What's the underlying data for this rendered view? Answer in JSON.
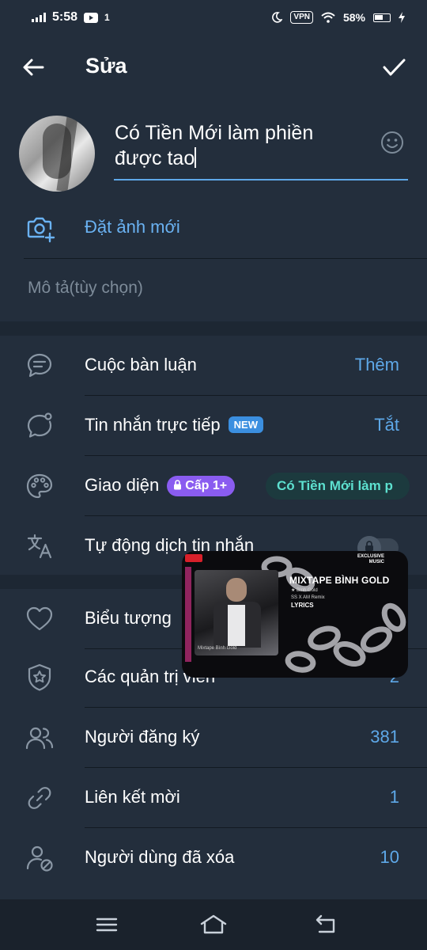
{
  "status_bar": {
    "time": "5:58",
    "notification_count": "1",
    "vpn": "VPN",
    "battery": "58%"
  },
  "app_bar": {
    "title": "Sửa"
  },
  "channel": {
    "name_line1": "Có Tiền Mới làm phiền",
    "name_line2": "được tao",
    "set_photo_label": "Đặt ảnh mới",
    "description_placeholder": "Mô tả(tùy chọn)"
  },
  "settings": {
    "discussion": {
      "label": "Cuộc bàn luận",
      "value": "Thêm"
    },
    "direct_messages": {
      "label": "Tin nhắn trực tiếp",
      "badge": "NEW",
      "value": "Tắt"
    },
    "appearance": {
      "label": "Giao diện",
      "badge": "Cấp 1+",
      "value": "Có Tiền Mới làm p"
    },
    "auto_translate": {
      "label": "Tự động dịch tin nhắn",
      "toggle_on": false
    }
  },
  "management": {
    "reactions": {
      "label": "Biểu tượng"
    },
    "admins": {
      "label": "Các quản trị viên",
      "value": "2"
    },
    "subscribers": {
      "label": "Người đăng ký",
      "value": "381"
    },
    "invite_links": {
      "label": "Liên kết mời",
      "value": "1"
    },
    "removed_users": {
      "label": "Người dùng đã xóa",
      "value": "10"
    }
  },
  "pip_overlay": {
    "title": "MIXTAPE BÌNH GOLD",
    "line1": "★ Bình Gold",
    "line2": "SS X AM Remix",
    "lyrics": "LYRICS",
    "exclusive": "EXCLUSIVE",
    "exclusive_sub": "MUSIC",
    "photo_caption": "Mixtape Bình Gold"
  },
  "colors": {
    "background": "#1d2733",
    "surface": "#232e3c",
    "accent": "#5ea8e8",
    "badge_new": "#3b8fe0",
    "badge_level": "#8a5cf0",
    "theme_chip_text": "#5de0cf"
  }
}
